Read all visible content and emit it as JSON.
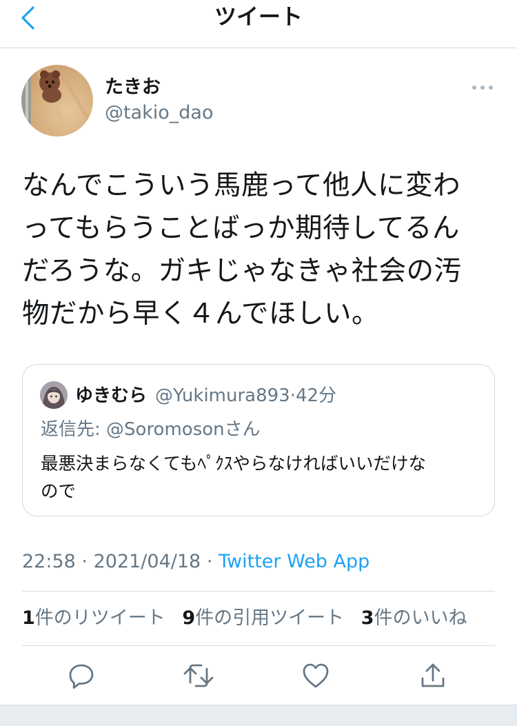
{
  "header": {
    "title": "ツイート",
    "back_icon": "chevron-left-icon"
  },
  "tweet": {
    "display_name": "たきお",
    "handle": "@takio_dao",
    "text_lines": [
      "なんでこういう馬鹿って他人に変わ",
      "ってもらうことばっか期待してるん",
      "だろうな。ガキじゃなきゃ社会の汚",
      "物だから早く４んでほしい。"
    ],
    "time": "22:58",
    "date": "2021/04/18",
    "separator": "·",
    "source": "Twitter Web App"
  },
  "quote": {
    "display_name": "ゆきむら",
    "handle": "@Yukimura893",
    "separator": "·",
    "time": "42分",
    "reply_prefix": "返信先: ",
    "reply_handle": "@Soromoson",
    "reply_suffix": "さん",
    "text_lines": [
      "最悪決まらなくてもﾍﾟｸｽやらなければいいだけな",
      "ので"
    ]
  },
  "stats": {
    "retweets_count": "1",
    "retweets_label": "件のリツイート",
    "quotes_count": "9",
    "quotes_label": "件の引用ツイート",
    "likes_count": "3",
    "likes_label": "件のいいね"
  },
  "actions": [
    "reply-icon",
    "retweet-icon",
    "like-icon",
    "share-icon"
  ],
  "colors": {
    "accent": "#1da1f2",
    "secondary_text": "#657786",
    "primary_text": "#14171a",
    "divider": "#d5dbe0"
  }
}
